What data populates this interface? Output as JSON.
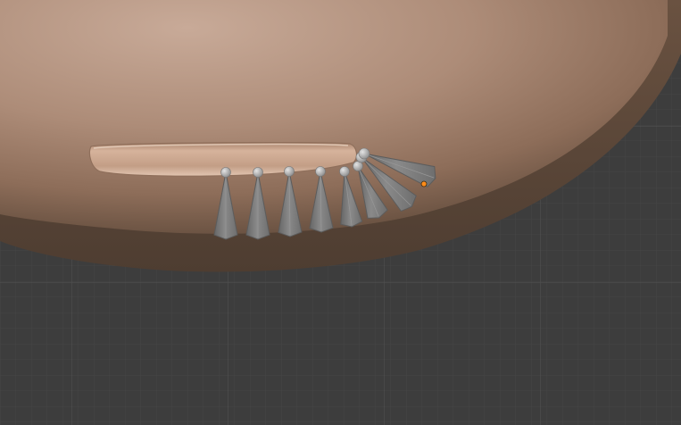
{
  "viewport": {
    "background_color": "#3d3d3d",
    "grid_minor_color": "#454545",
    "grid_major_color": "#4d4d4d"
  },
  "mesh": {
    "object": "head-sphere",
    "skin_light": "#c4a592",
    "skin_mid": "#9a7a66",
    "skin_dark": "#5a4636",
    "slot_color": "#d0ad96"
  },
  "armature": {
    "bone_fill": "#7a7a7a",
    "bone_edge": "#5c5c5c",
    "joint_color": "#b9b9b9",
    "active_origin_color": "#ff8c1a",
    "bone_count": 7,
    "active_bone_index": 6
  },
  "icons": {
    "bone": "octahedral-bone-icon",
    "joint": "bone-joint-icon",
    "origin": "object-origin-icon"
  }
}
